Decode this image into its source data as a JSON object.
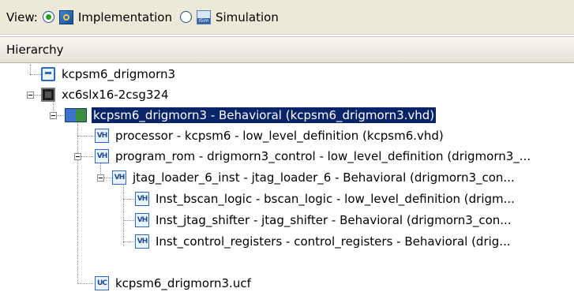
{
  "view": {
    "label": "View:",
    "options": [
      {
        "label": "Implementation",
        "selected": true,
        "icon": "implementation-icon"
      },
      {
        "label": "Simulation",
        "selected": false,
        "icon": "isim-icon"
      }
    ]
  },
  "hierarchy": {
    "header": "Hierarchy",
    "items": [
      {
        "label": "kcpsm6_drigmorn3",
        "icon": "project-sheet-icon"
      },
      {
        "label": "xc6slx16-2csg324",
        "icon": "fpga-chip-icon"
      },
      {
        "label": "kcpsm6_drigmorn3 - Behavioral (kcpsm6_drigmorn3.vhd)",
        "icon": "top-module-icon",
        "selected": true
      },
      {
        "label": "processor - kcpsm6 - low_level_definition (kcpsm6.vhd)",
        "icon": "vhdl-file-icon"
      },
      {
        "label": "program_rom - drigmorn3_control - low_level_definition (drigmorn3_...",
        "icon": "vhdl-file-icon"
      },
      {
        "label": "jtag_loader_6_inst - jtag_loader_6 - Behavioral (drigmorn3_con...",
        "icon": "vhdl-file-icon"
      },
      {
        "label": "Inst_bscan_logic - bscan_logic - low_level_definition (drigm...",
        "icon": "vhdl-file-icon"
      },
      {
        "label": "Inst_jtag_shifter - jtag_shifter - Behavioral (drigmorn3_con...",
        "icon": "vhdl-file-icon"
      },
      {
        "label": "Inst_control_registers - control_registers - Behavioral (drig...",
        "icon": "vhdl-file-icon"
      },
      {
        "label": "kcpsm6_drigmorn3.ucf",
        "icon": "ucf-file-icon"
      }
    ]
  }
}
